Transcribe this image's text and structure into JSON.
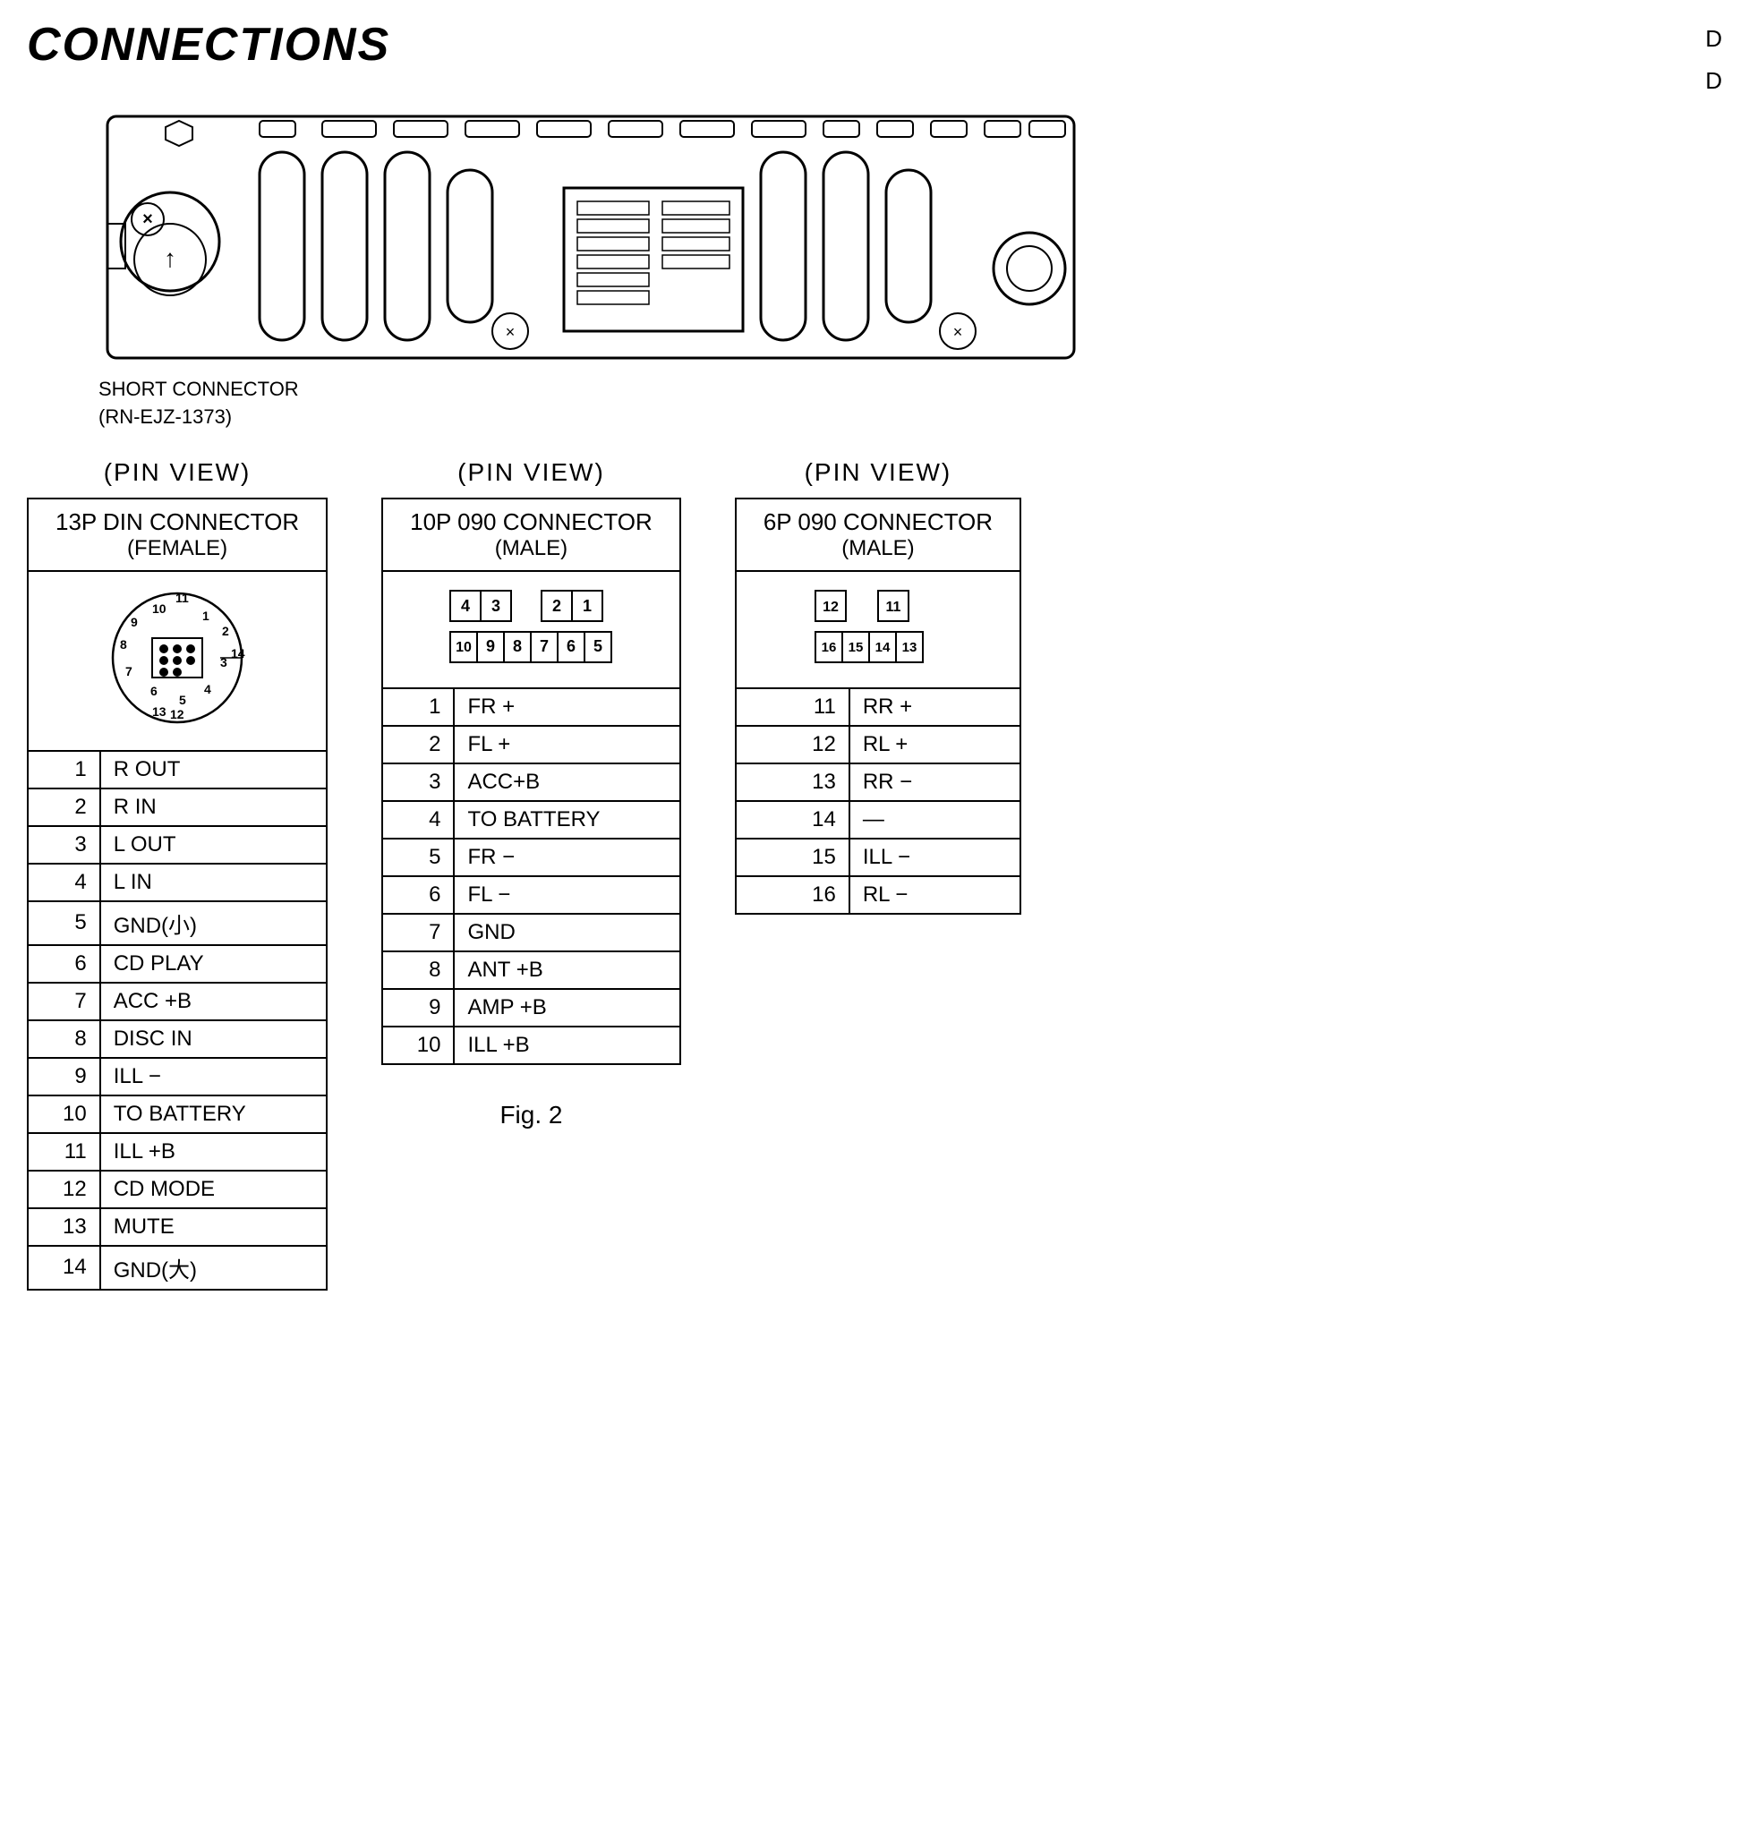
{
  "header": {
    "title": "CONNECTIONS",
    "top_right": [
      "D",
      "D"
    ]
  },
  "short_connector": {
    "label": "SHORT CONNECTOR",
    "part_number": "(RN-EJZ-1373)"
  },
  "fig_label": "Fig. 2",
  "connector_13p": {
    "pin_view": "(PIN  VIEW)",
    "title": "13P DIN CONNECTOR",
    "subtitle": "(FEMALE)",
    "pins": [
      {
        "num": "1",
        "label": "R OUT"
      },
      {
        "num": "2",
        "label": "R IN"
      },
      {
        "num": "3",
        "label": "L OUT"
      },
      {
        "num": "4",
        "label": "L IN"
      },
      {
        "num": "5",
        "label": "GND(小)"
      },
      {
        "num": "6",
        "label": "CD PLAY"
      },
      {
        "num": "7",
        "label": "ACC +B"
      },
      {
        "num": "8",
        "label": "DISC IN"
      },
      {
        "num": "9",
        "label": "ILL −"
      },
      {
        "num": "10",
        "label": "TO BATTERY"
      },
      {
        "num": "11",
        "label": "ILL +B"
      },
      {
        "num": "12",
        "label": "CD MODE"
      },
      {
        "num": "13",
        "label": "MUTE"
      },
      {
        "num": "14",
        "label": "GND(大)"
      }
    ]
  },
  "connector_10p": {
    "pin_view": "(PIN  VIEW)",
    "title": "10P 090 CONNECTOR",
    "subtitle": "(MALE)",
    "pins": [
      {
        "num": "1",
        "label": "FR +"
      },
      {
        "num": "2",
        "label": "FL +"
      },
      {
        "num": "3",
        "label": "ACC+B"
      },
      {
        "num": "4",
        "label": "TO BATTERY"
      },
      {
        "num": "5",
        "label": "FR −"
      },
      {
        "num": "6",
        "label": "FL −"
      },
      {
        "num": "7",
        "label": "GND"
      },
      {
        "num": "8",
        "label": "ANT +B"
      },
      {
        "num": "9",
        "label": "AMP +B"
      },
      {
        "num": "10",
        "label": "ILL +B"
      }
    ],
    "diagram_top_row": [
      "4",
      "3",
      "",
      "2",
      "1"
    ],
    "diagram_bot_row": [
      "10",
      "9",
      "8",
      "7",
      "6",
      "5"
    ]
  },
  "connector_6p": {
    "pin_view": "(PIN  VIEW)",
    "title": "6P 090 CONNECTOR",
    "subtitle": "(MALE)",
    "pins": [
      {
        "num": "11",
        "label": "RR +"
      },
      {
        "num": "12",
        "label": "RL +"
      },
      {
        "num": "13",
        "label": "RR −"
      },
      {
        "num": "14",
        "label": "—"
      },
      {
        "num": "15",
        "label": "ILL −"
      },
      {
        "num": "16",
        "label": "RL −"
      }
    ],
    "diagram_top_row": [
      "12",
      "",
      "11"
    ],
    "diagram_bot_row": [
      "16",
      "15",
      "14",
      "13"
    ]
  }
}
